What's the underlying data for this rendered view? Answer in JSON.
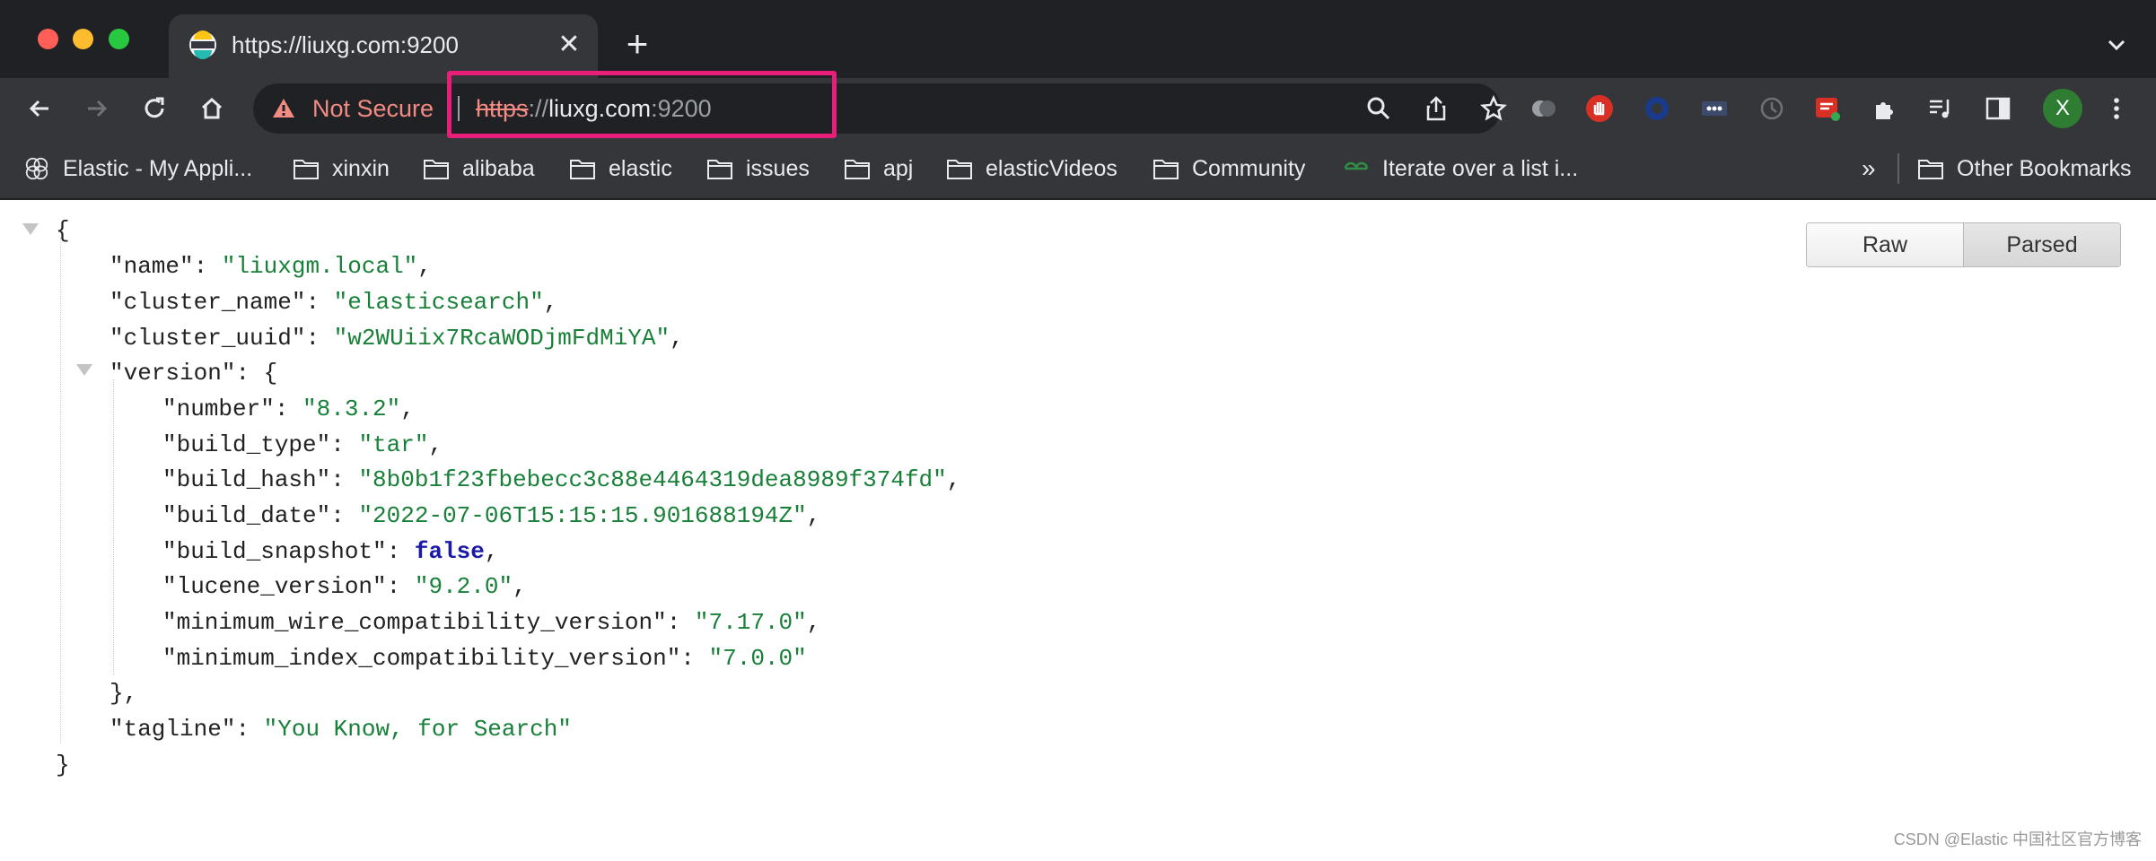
{
  "tab": {
    "title": "https://liuxg.com:9200",
    "close_glyph": "✕",
    "new_tab_glyph": "+"
  },
  "omnibox": {
    "security_label": "Not Secure",
    "url_scheme": "https",
    "url_separator": "://",
    "url_host": "liuxg.com",
    "url_port": ":9200"
  },
  "profile": {
    "initial": "X"
  },
  "bookmarks": {
    "items": [
      {
        "label": "Elastic - My Appli...",
        "icon": "elastic-logo-icon"
      },
      {
        "label": "xinxin",
        "icon": "folder-icon"
      },
      {
        "label": "alibaba",
        "icon": "folder-icon"
      },
      {
        "label": "elastic",
        "icon": "folder-icon"
      },
      {
        "label": "issues",
        "icon": "folder-icon"
      },
      {
        "label": "apj",
        "icon": "folder-icon"
      },
      {
        "label": "elasticVideos",
        "icon": "folder-icon"
      },
      {
        "label": "Community",
        "icon": "folder-icon"
      },
      {
        "label": "Iterate over a list i...",
        "icon": "geeksforgeeks-icon"
      }
    ],
    "overflow_glyph": "»",
    "other_label": "Other Bookmarks"
  },
  "viewer": {
    "raw_label": "Raw",
    "parsed_label": "Parsed",
    "selected": "Parsed"
  },
  "json": {
    "open_brace": "{",
    "close_brace": "}",
    "name_key": "\"name\"",
    "name_value": "\"liuxgm.local\"",
    "cluster_name_key": "\"cluster_name\"",
    "cluster_name_value": "\"elasticsearch\"",
    "cluster_uuid_key": "\"cluster_uuid\"",
    "cluster_uuid_value": "\"w2WUiix7RcaWODjmFdMiYA\"",
    "version_key": "\"version\"",
    "version_close": "},",
    "number_key": "\"number\"",
    "number_value": "\"8.3.2\"",
    "build_type_key": "\"build_type\"",
    "build_type_value": "\"tar\"",
    "build_hash_key": "\"build_hash\"",
    "build_hash_value": "\"8b0b1f23fbebecc3c88e4464319dea8989f374fd\"",
    "build_date_key": "\"build_date\"",
    "build_date_value": "\"2022-07-06T15:15:15.901688194Z\"",
    "build_snapshot_key": "\"build_snapshot\"",
    "build_snapshot_value": "false",
    "lucene_version_key": "\"lucene_version\"",
    "lucene_version_value": "\"9.2.0\"",
    "min_wire_key": "\"minimum_wire_compatibility_version\"",
    "min_wire_value": "\"7.17.0\"",
    "min_index_key": "\"minimum_index_compatibility_version\"",
    "min_index_value": "\"7.0.0\"",
    "tagline_key": "\"tagline\"",
    "tagline_value": "\"You Know, for Search\""
  },
  "watermark": "CSDN @Elastic 中国社区官方博客",
  "colors": {
    "highlight_border": "#e91e7a",
    "string_value": "#188038",
    "boolean_value": "#1a1aa6",
    "not_secure": "#f28b82"
  }
}
